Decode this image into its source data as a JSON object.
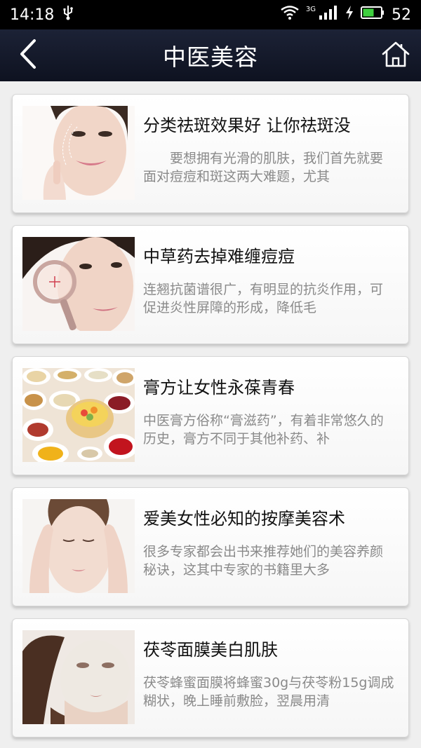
{
  "status": {
    "time": "14:18",
    "network": "3G",
    "battery": "52",
    "icons": [
      "usb-icon",
      "wifi-icon",
      "signal-icon",
      "charging-icon",
      "battery-icon"
    ]
  },
  "header": {
    "title": "中医美容",
    "back_icon": "back-arrow-icon",
    "home_icon": "home-icon"
  },
  "articles": [
    {
      "title": "分类祛斑效果好 让你祛斑没",
      "desc": "　　要想拥有光滑的肌肤，我们首先就要面对痘痘和斑这两大难题，尤其"
    },
    {
      "title": "中草药去掉难缠痘痘",
      "desc": "连翘抗菌谱很广，有明显的抗炎作用，可促进炎性屏障的形成，降低毛"
    },
    {
      "title": "膏方让女性永葆青春",
      "desc": "中医膏方俗称“膏滋药”，有着非常悠久的历史，膏方不同于其他补药、补"
    },
    {
      "title": "爱美女性必知的按摩美容术",
      "desc": "很多专家都会出书来推荐她们的美容养颜秘诀，这其中专家的书籍里大多"
    },
    {
      "title": "茯苓面膜美白肌肤",
      "desc": "茯苓蜂蜜面膜将蜂蜜30g与茯苓粉15g调成糊状，晚上睡前敷脸，翌晨用清"
    }
  ]
}
